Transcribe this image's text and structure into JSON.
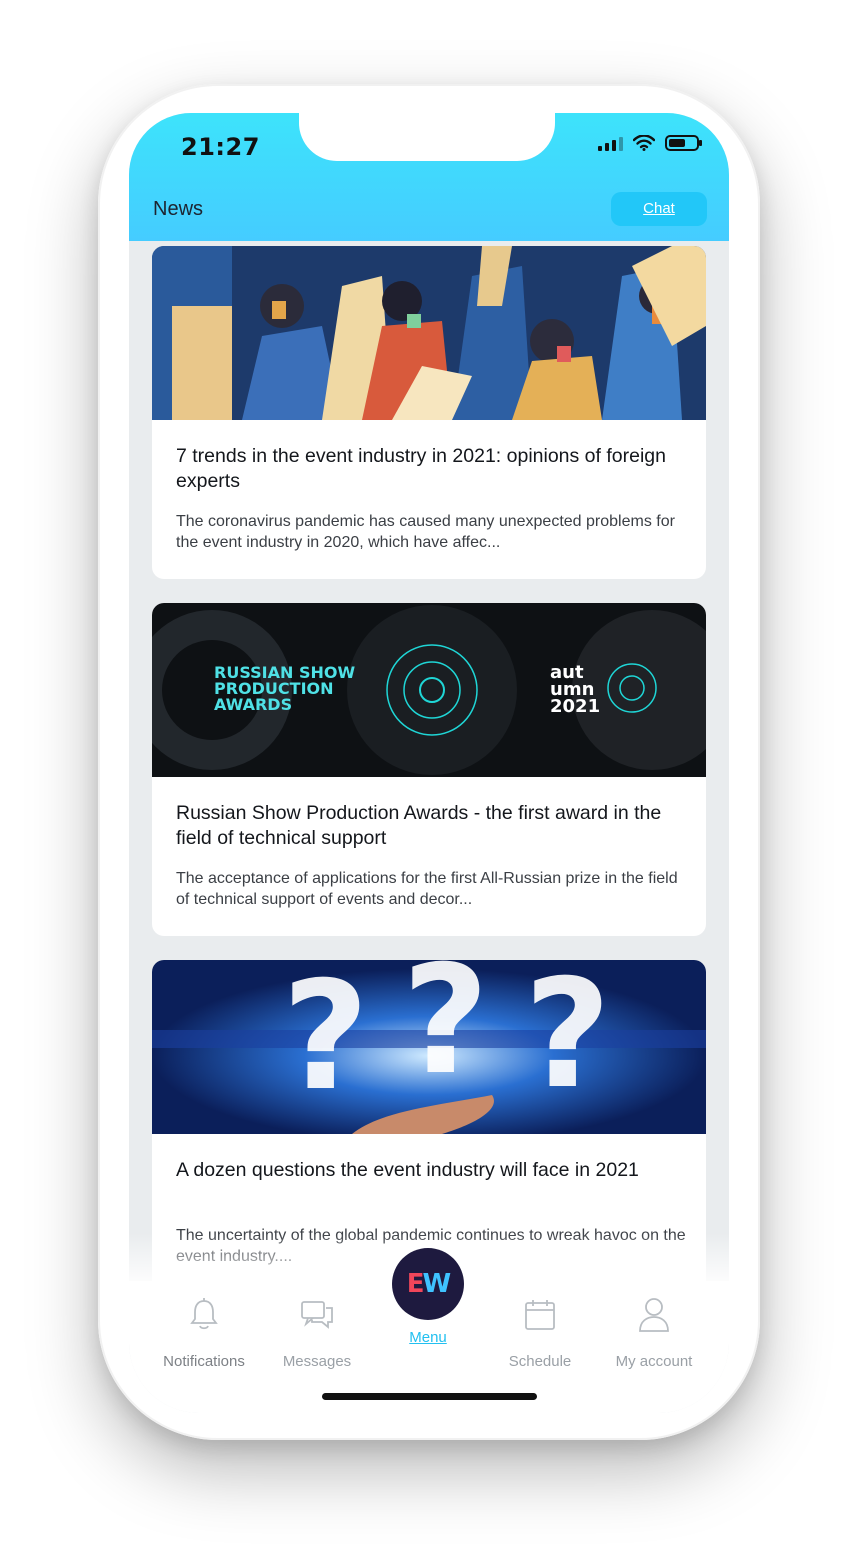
{
  "status_bar": {
    "time": "21:27",
    "battery_level": 0.6
  },
  "header": {
    "title": "News",
    "chat_label": "Chat"
  },
  "articles": [
    {
      "title": "7 trends in the event industry in 2021: opinions of foreign experts",
      "excerpt": "The coronavirus pandemic has caused many unexpected problems for the event industry in 2020, which have affec..."
    },
    {
      "title": "Russian Show Production Awards - the first award in the field of technical support",
      "excerpt": "The acceptance of applications for the first All-Russian prize in the field of technical support of events and decor...",
      "image_text": {
        "left": "RUSSIAN SHOW\nPRODUCTION\nAWARDS",
        "right": "aut\numn\n2021"
      }
    },
    {
      "title": "A dozen questions the event industry will face in 2021",
      "excerpt": "The uncertainty of the global pandemic continues to wreak havoc on the event industry...."
    }
  ],
  "tabbar": {
    "items": [
      {
        "label": "Notifications",
        "icon": "bell-icon"
      },
      {
        "label": "Messages",
        "icon": "chat-bubbles-icon"
      },
      {
        "label": "Menu",
        "icon": "ew-logo",
        "logo_text": "EW"
      },
      {
        "label": "Schedule",
        "icon": "calendar-icon"
      },
      {
        "label": "My account",
        "icon": "user-icon"
      }
    ]
  },
  "colors": {
    "header_start": "#3de3fb",
    "header_end": "#45ccff",
    "accent": "#22c0f0",
    "menu_bg": "#1e1a3f"
  }
}
